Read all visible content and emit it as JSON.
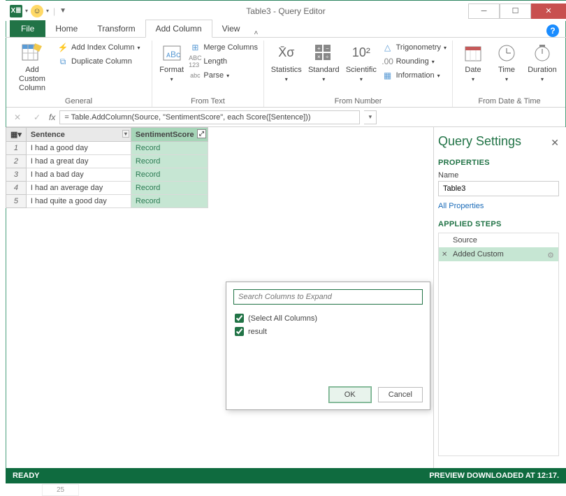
{
  "window": {
    "title": "Table3 - Query Editor"
  },
  "tabs": {
    "file": "File",
    "items": [
      "Home",
      "Transform",
      "Add Column",
      "View"
    ],
    "active_index": 2
  },
  "ribbon": {
    "general": {
      "add_custom": "Add Custom Column",
      "add_index": "Add Index Column",
      "duplicate": "Duplicate Column",
      "label": "General"
    },
    "from_text": {
      "format": "Format",
      "merge": "Merge Columns",
      "length": "Length",
      "parse": "Parse",
      "label": "From Text"
    },
    "from_number": {
      "statistics": "Statistics",
      "standard": "Standard",
      "scientific": "Scientific",
      "trig": "Trigonometry",
      "rounding": "Rounding",
      "information": "Information",
      "label": "From Number"
    },
    "from_dt": {
      "date": "Date",
      "time": "Time",
      "duration": "Duration",
      "label": "From Date & Time"
    }
  },
  "formula": {
    "value": "= Table.AddColumn(Source, \"SentimentScore\", each Score([Sentence]))"
  },
  "table": {
    "columns": [
      "Sentence",
      "SentimentScore"
    ],
    "rows": [
      {
        "n": "1",
        "sentence": "I had a good day",
        "score": "Record"
      },
      {
        "n": "2",
        "sentence": "I had a great day",
        "score": "Record"
      },
      {
        "n": "3",
        "sentence": "I had a bad day",
        "score": "Record"
      },
      {
        "n": "4",
        "sentence": "I had an average day",
        "score": "Record"
      },
      {
        "n": "5",
        "sentence": "I had quite a good day",
        "score": "Record"
      }
    ]
  },
  "popup": {
    "search_placeholder": "Search Columns to Expand",
    "select_all": "(Select All Columns)",
    "options": [
      "result"
    ],
    "ok": "OK",
    "cancel": "Cancel"
  },
  "settings": {
    "title": "Query Settings",
    "properties_label": "PROPERTIES",
    "name_label": "Name",
    "name_value": "Table3",
    "all_props": "All Properties",
    "applied_label": "APPLIED STEPS",
    "steps": [
      {
        "label": "Source",
        "active": false
      },
      {
        "label": "Added Custom",
        "active": true
      }
    ]
  },
  "status": {
    "left": "READY",
    "right": "PREVIEW DOWNLOADED AT 12:17."
  },
  "misc": {
    "grid_hint": "25"
  }
}
